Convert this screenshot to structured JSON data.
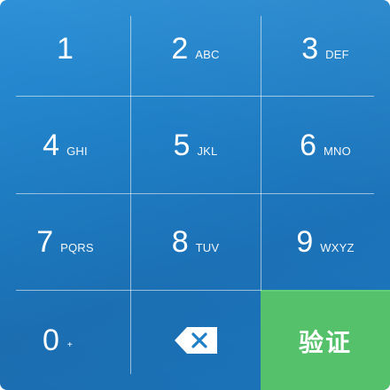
{
  "keys": [
    {
      "digit": "1",
      "letters": ""
    },
    {
      "digit": "2",
      "letters": "ABC"
    },
    {
      "digit": "3",
      "letters": "DEF"
    },
    {
      "digit": "4",
      "letters": "GHI"
    },
    {
      "digit": "5",
      "letters": "JKL"
    },
    {
      "digit": "6",
      "letters": "MNO"
    },
    {
      "digit": "7",
      "letters": "PQRS"
    },
    {
      "digit": "8",
      "letters": "TUV"
    },
    {
      "digit": "9",
      "letters": "WXYZ"
    }
  ],
  "zero_key": {
    "digit": "0",
    "extra": "+"
  },
  "backspace": {
    "icon": "backspace-icon"
  },
  "verify_button": {
    "label": "验证"
  },
  "colors": {
    "keypad_blue": "#1f7fc6",
    "verify_green": "#55c26b",
    "text": "#ffffff"
  }
}
